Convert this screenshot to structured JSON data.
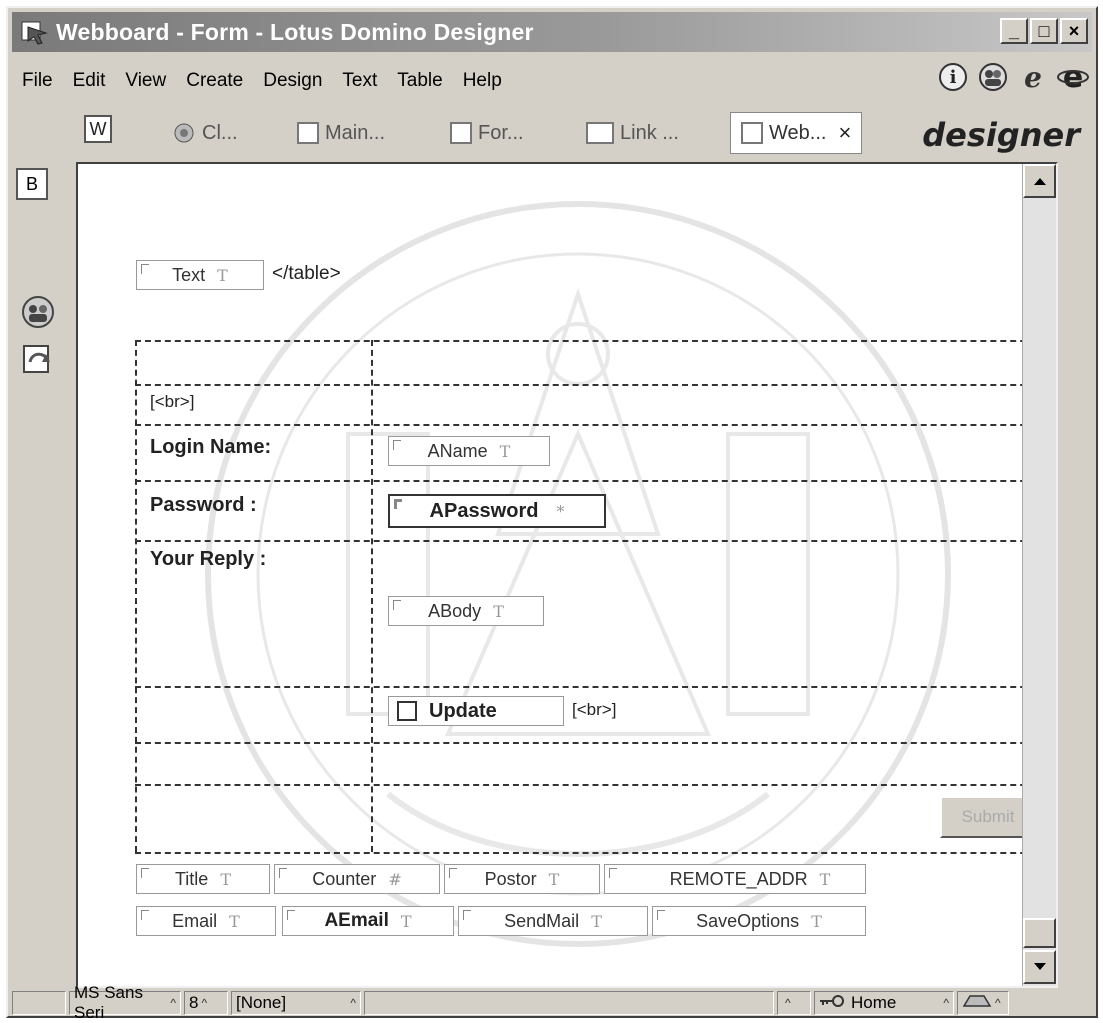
{
  "window": {
    "title": "Webboard - Form - Lotus Domino Designer",
    "buttons": {
      "minimize": "_",
      "maximize": "□",
      "close": "×"
    }
  },
  "menu": [
    "File",
    "Edit",
    "View",
    "Create",
    "Design",
    "Text",
    "Table",
    "Help"
  ],
  "tabs": [
    {
      "label": "Cl..."
    },
    {
      "label": "Main..."
    },
    {
      "label": "For..."
    },
    {
      "label": "Link ..."
    },
    {
      "label": "Web..."
    }
  ],
  "tab_close": "×",
  "brand": "designer",
  "sidebar": {
    "b_icon": "B",
    "w_icon": "W"
  },
  "form": {
    "text_field": "Text",
    "text_field_type": "T",
    "table_tag": "</table>",
    "br_tag": "[<br>]",
    "login_label": "Login Name:",
    "aname_field": "AName",
    "aname_type": "T",
    "password_label": "Password :",
    "apassword_field": "APassword",
    "apassword_type": "*",
    "reply_label": "Your Reply :",
    "abody_field": "ABody",
    "abody_type": "T",
    "update_label": "Update",
    "update_br": "[<br>]",
    "submit_label": "Submit",
    "hidden_fields_row1": [
      {
        "name": "Title",
        "type": "T"
      },
      {
        "name": "Counter",
        "type": "#"
      },
      {
        "name": "Postor",
        "type": "T"
      },
      {
        "name": "REMOTE_ADDR",
        "type": "T"
      }
    ],
    "hidden_fields_row2": [
      {
        "name": "Email",
        "type": "T"
      },
      {
        "name": "AEmail",
        "type": "T"
      },
      {
        "name": "SendMail",
        "type": "T"
      },
      {
        "name": "SaveOptions",
        "type": "T"
      }
    ]
  },
  "status": {
    "font": "MS Sans Seri",
    "size": "8",
    "style": "[None]",
    "location": "Home"
  }
}
